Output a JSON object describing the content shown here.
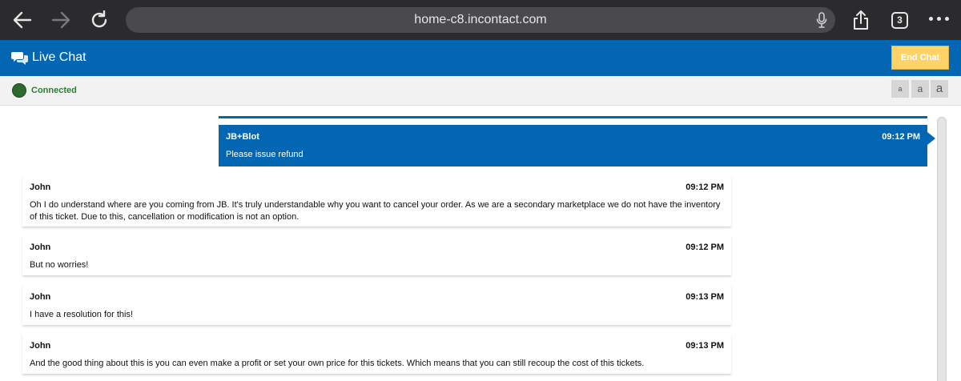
{
  "browser": {
    "url": "home-c8.incontact.com",
    "tab_count": "3"
  },
  "header": {
    "title": "Live Chat",
    "end_chat_label": "End Chat"
  },
  "status": {
    "text": "Connected",
    "font_sizes": [
      "a",
      "a",
      "a"
    ]
  },
  "messages": [
    {
      "sender": "JB+Blot",
      "time": "09:12 PM",
      "text": "Please issue refund",
      "direction": "out"
    },
    {
      "sender": "John",
      "time": "09:12 PM",
      "text": "Oh I do understand where are you coming from JB. It's truly understandable why you want to cancel your order. As we are a secondary marketplace we do not have the inventory of this ticket. Due to this, cancellation or modification is not an option.",
      "direction": "in"
    },
    {
      "sender": "John",
      "time": "09:12 PM",
      "text": "But no worries!",
      "direction": "in"
    },
    {
      "sender": "John",
      "time": "09:13 PM",
      "text": "I have a resolution for this!",
      "direction": "in"
    },
    {
      "sender": "John",
      "time": "09:13 PM",
      "text": "And the good thing about this is you can even make a profit or set your own price for this tickets. Which means that you can still recoup the cost of this tickets.",
      "direction": "in"
    }
  ],
  "colors": {
    "brand_blue": "#0366b3",
    "end_chat": "#ffd267",
    "connected": "#2e7d32"
  }
}
